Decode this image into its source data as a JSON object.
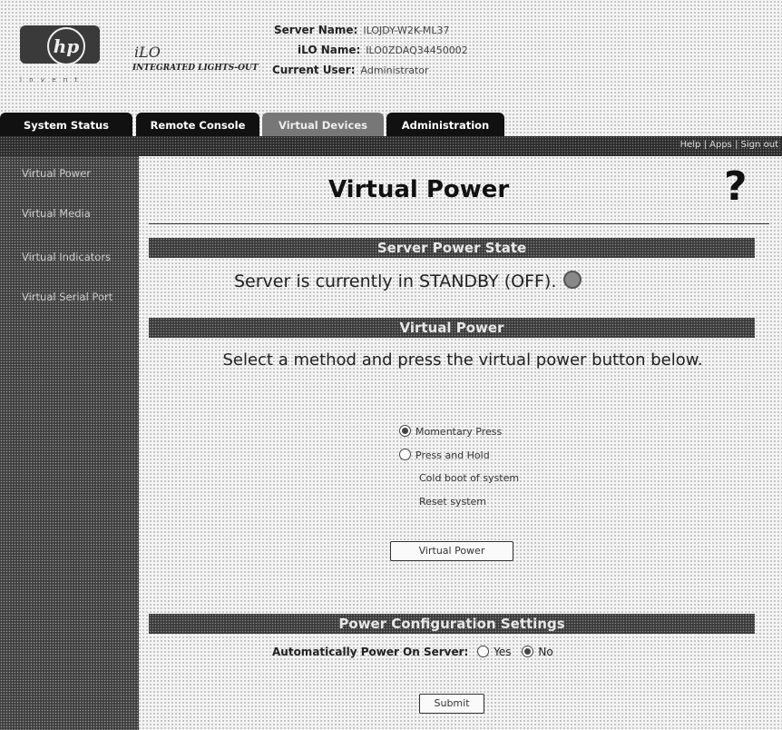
{
  "header": {
    "logo_text": "hp",
    "logo_tagline": "i n v e n t",
    "product": "iLO",
    "product_sub": "INTEGRATED LIGHTS-OUT",
    "server_name_label": "Server Name:",
    "server_name_value": "ILOJDY-W2K-ML37",
    "ilo_name_label": "iLO Name:",
    "ilo_name_value": "ILO0ZDAQ34450002",
    "current_user_label": "Current User:",
    "current_user_value": "Administrator"
  },
  "tabs": [
    {
      "label": "System Status"
    },
    {
      "label": "Remote Console"
    },
    {
      "label": "Virtual Devices",
      "active": true
    },
    {
      "label": "Administration"
    }
  ],
  "help_links": "Help | Apps | Sign out",
  "sidebar": {
    "items": [
      {
        "label": "Virtual Power"
      },
      {
        "label": "Virtual Media"
      },
      {
        "label": "Virtual Indicators"
      },
      {
        "label": "Virtual Serial Port"
      }
    ]
  },
  "main": {
    "title": "Virtual Power",
    "help_icon": "?",
    "sections": {
      "power_state": "Server Power State",
      "virtual_power": "Virtual Power",
      "power_config": "Power Configuration Settings"
    },
    "power_state_text": "Server is currently in STANDBY (OFF).",
    "status_icon": "power-status-icon",
    "instructions": "Select a method and press the virtual power button below.",
    "options": [
      {
        "label": "Momentary Press",
        "checked": true
      },
      {
        "label": "Press and Hold",
        "checked": false
      },
      {
        "label": "Cold boot of system",
        "checked": false
      },
      {
        "label": "Reset system",
        "checked": false
      }
    ],
    "virtual_power_button": "Virtual Power",
    "auto_power_label": "Automatically Power On Server:",
    "auto_power_options": [
      {
        "label": "Yes",
        "checked": false
      },
      {
        "label": "No",
        "checked": true
      }
    ],
    "submit_button": "Submit"
  }
}
